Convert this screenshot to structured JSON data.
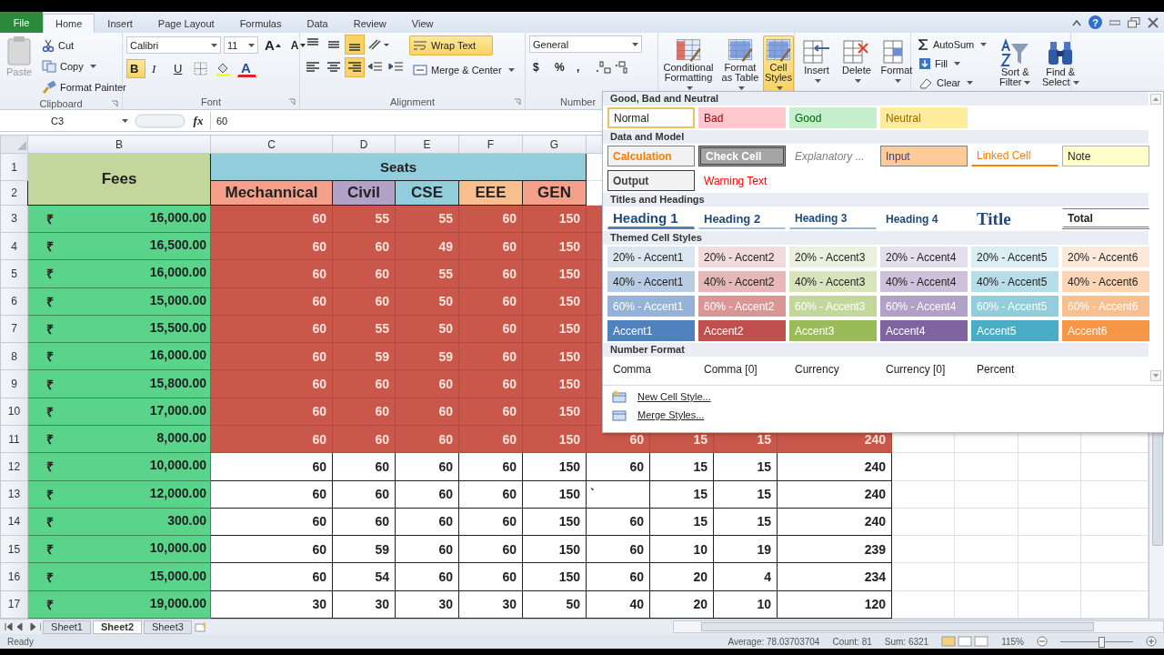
{
  "file_tab": "File",
  "ribbon_tabs": [
    {
      "label": "Home",
      "selected": true
    },
    {
      "label": "Insert",
      "selected": false
    },
    {
      "label": "Page Layout",
      "selected": false
    },
    {
      "label": "Formulas",
      "selected": false
    },
    {
      "label": "Data",
      "selected": false
    },
    {
      "label": "Review",
      "selected": false
    },
    {
      "label": "View",
      "selected": false
    }
  ],
  "help": "?",
  "clipboard": {
    "paste": "Paste",
    "paste_disabled": true,
    "cut": "Cut",
    "copy": "Copy",
    "format_painter": "Format Painter",
    "label": "Clipboard"
  },
  "font": {
    "family": "Calibri",
    "size": "11",
    "grow": "A",
    "shrink": "A",
    "bold": "B",
    "italic": "I",
    "underline": "U",
    "color_letter": "A",
    "bold_on": true,
    "label": "Font"
  },
  "alignment": {
    "vertical_buttons": [
      {
        "selected": false
      },
      {
        "selected": false
      },
      {
        "selected": true
      }
    ],
    "horizontal_buttons": [
      {
        "selected": false
      },
      {
        "selected": false
      },
      {
        "selected": true
      }
    ],
    "wrap_text": "Wrap Text",
    "wrap_on": true,
    "merge": "Merge & Center",
    "label": "Alignment"
  },
  "number": {
    "format": "General",
    "symbols": [
      "$",
      "%",
      ","
    ],
    "label": "Number"
  },
  "styles": [
    {
      "label": "Conditional Formatting",
      "selected": false
    },
    {
      "label": "Format as Table",
      "selected": false
    },
    {
      "label": "Cell Styles",
      "selected": true
    }
  ],
  "cells": [
    "Insert",
    "Delete",
    "Format"
  ],
  "editing": {
    "autosum": "AutoSum",
    "fill": "Fill",
    "clear": "Clear",
    "sort": "Sort & Filter",
    "find": "Find & Select"
  },
  "formula_bar": {
    "name_box": "C3",
    "function_label": "fx",
    "formula": "60"
  },
  "column_headers": [
    "B",
    "C",
    "D",
    "E",
    "F",
    "G"
  ],
  "sheet": {
    "header_rows": [
      "1",
      "2"
    ],
    "fees_header": "Fees",
    "seats_header": "Seats",
    "subheaders": [
      {
        "label": "Mechannical",
        "color": "#f4a08a"
      },
      {
        "label": "Civil",
        "color": "#b3a2c7"
      },
      {
        "label": "CSE",
        "color": "#92cddc"
      },
      {
        "label": "EEE",
        "color": "#fabf8f"
      },
      {
        "label": "GEN",
        "color": "#f4a08a"
      }
    ],
    "rows": [
      {
        "number": "3",
        "symbol": "₹",
        "fee": "16,000.00",
        "highlighted": true,
        "values": [
          "60",
          "55",
          "55",
          "60",
          "150"
        ]
      },
      {
        "number": "4",
        "symbol": "₹",
        "fee": "16,500.00",
        "highlighted": true,
        "values": [
          "60",
          "60",
          "49",
          "60",
          "150"
        ]
      },
      {
        "number": "5",
        "symbol": "₹",
        "fee": "16,000.00",
        "highlighted": true,
        "values": [
          "60",
          "60",
          "55",
          "60",
          "150"
        ]
      },
      {
        "number": "6",
        "symbol": "₹",
        "fee": "15,000.00",
        "highlighted": true,
        "values": [
          "60",
          "60",
          "50",
          "60",
          "150"
        ]
      },
      {
        "number": "7",
        "symbol": "₹",
        "fee": "15,500.00",
        "highlighted": true,
        "values": [
          "60",
          "55",
          "50",
          "60",
          "150"
        ]
      },
      {
        "number": "8",
        "symbol": "₹",
        "fee": "16,000.00",
        "highlighted": true,
        "values": [
          "60",
          "59",
          "59",
          "60",
          "150"
        ]
      },
      {
        "number": "9",
        "symbol": "₹",
        "fee": "15,800.00",
        "highlighted": true,
        "values": [
          "60",
          "60",
          "60",
          "60",
          "150"
        ]
      },
      {
        "number": "10",
        "symbol": "₹",
        "fee": "17,000.00",
        "highlighted": true,
        "values": [
          "60",
          "60",
          "60",
          "60",
          "150"
        ]
      },
      {
        "number": "11",
        "symbol": "₹",
        "fee": "8,000.00",
        "highlighted": true,
        "values": [
          "60",
          "60",
          "60",
          "60",
          "150",
          "60",
          "15",
          "15",
          "240"
        ]
      },
      {
        "number": "12",
        "symbol": "₹",
        "fee": "10,000.00",
        "highlighted": false,
        "values": [
          "60",
          "60",
          "60",
          "60",
          "150",
          "60",
          "15",
          "15",
          "240"
        ]
      },
      {
        "number": "13",
        "symbol": "₹",
        "fee": "12,000.00",
        "highlighted": false,
        "values": [
          "60",
          "60",
          "60",
          "60",
          "150",
          "`",
          "15",
          "15",
          "240"
        ]
      },
      {
        "number": "14",
        "symbol": "₹",
        "fee": "300.00",
        "highlighted": false,
        "values": [
          "60",
          "60",
          "60",
          "60",
          "150",
          "60",
          "15",
          "15",
          "240"
        ]
      },
      {
        "number": "15",
        "symbol": "₹",
        "fee": "10,000.00",
        "highlighted": false,
        "values": [
          "60",
          "59",
          "60",
          "60",
          "150",
          "60",
          "10",
          "19",
          "239"
        ]
      },
      {
        "number": "16",
        "symbol": "₹",
        "fee": "15,000.00",
        "highlighted": false,
        "values": [
          "60",
          "54",
          "60",
          "60",
          "150",
          "60",
          "20",
          "4",
          "234"
        ]
      },
      {
        "number": "17",
        "symbol": "₹",
        "fee": "19,000.00",
        "highlighted": false,
        "values": [
          "30",
          "30",
          "30",
          "30",
          "50",
          "40",
          "20",
          "10",
          "120"
        ]
      }
    ]
  },
  "cell_styles": {
    "sections": [
      {
        "title": "Good, Bad and Neutral",
        "rows": [
          [
            {
              "label": "Normal",
              "kind": "normal",
              "selected": true
            },
            {
              "label": "Bad",
              "kind": "bad",
              "selected": false
            },
            {
              "label": "Good",
              "kind": "good",
              "selected": false
            },
            {
              "label": "Neutral",
              "kind": "neutral",
              "selected": false
            }
          ]
        ]
      },
      {
        "title": "Data and Model",
        "rows": [
          [
            {
              "label": "Calculation",
              "kind": "calculation",
              "selected": false
            },
            {
              "label": "Check Cell",
              "kind": "check",
              "selected": false
            },
            {
              "label": "Explanatory ...",
              "kind": "explanatory",
              "selected": false
            },
            {
              "label": "Input",
              "kind": "input",
              "selected": false
            },
            {
              "label": "Linked Cell",
              "kind": "linked",
              "selected": false
            },
            {
              "label": "Note",
              "kind": "note",
              "selected": false
            }
          ],
          [
            {
              "label": "Output",
              "kind": "output",
              "selected": false
            },
            {
              "label": "Warning Text",
              "kind": "warning",
              "selected": false
            }
          ]
        ]
      },
      {
        "title": "Titles and Headings",
        "rows": [
          [
            {
              "label": "Heading 1",
              "kind": "h1",
              "selected": false
            },
            {
              "label": "Heading 2",
              "kind": "h2",
              "selected": false
            },
            {
              "label": "Heading 3",
              "kind": "h3",
              "selected": false
            },
            {
              "label": "Heading 4",
              "kind": "h4",
              "selected": false
            },
            {
              "label": "Title",
              "kind": "title",
              "selected": false
            },
            {
              "label": "Total",
              "kind": "total",
              "selected": false
            }
          ]
        ]
      },
      {
        "title": "Themed Cell Styles",
        "rows": [
          [
            {
              "label": "20% - Accent1",
              "kind": "percent20",
              "selected": false
            },
            {
              "label": "20% - Accent2",
              "kind": "percent20",
              "selected": false
            },
            {
              "label": "20% - Accent3",
              "kind": "percent20",
              "selected": false
            },
            {
              "label": "20% - Accent4",
              "kind": "percent20",
              "selected": false
            },
            {
              "label": "20% - Accent5",
              "kind": "percent20",
              "selected": false
            },
            {
              "label": "20% - Accent6",
              "kind": "percent20",
              "selected": false
            }
          ],
          [
            {
              "label": "40% - Accent1",
              "kind": "percent40",
              "selected": false
            },
            {
              "label": "40% - Accent2",
              "kind": "percent40",
              "selected": false
            },
            {
              "label": "40% - Accent3",
              "kind": "percent40",
              "selected": false
            },
            {
              "label": "40% - Accent4",
              "kind": "percent40",
              "selected": false
            },
            {
              "label": "40% - Accent5",
              "kind": "percent40",
              "selected": false
            },
            {
              "label": "40% - Accent6",
              "kind": "percent40",
              "selected": false
            }
          ],
          [
            {
              "label": "60% - Accent1",
              "kind": "percent60",
              "selected": false
            },
            {
              "label": "60% - Accent2",
              "kind": "percent60",
              "selected": false
            },
            {
              "label": "60% - Accent3",
              "kind": "percent60",
              "selected": false
            },
            {
              "label": "60% - Accent4",
              "kind": "percent60",
              "selected": false
            },
            {
              "label": "60% - Accent5",
              "kind": "percent60",
              "selected": false
            },
            {
              "label": "60% - Accent6",
              "kind": "percent60",
              "selected": false
            }
          ],
          [
            {
              "label": "Accent1",
              "kind": "accent",
              "selected": false
            },
            {
              "label": "Accent2",
              "kind": "accent",
              "selected": false
            },
            {
              "label": "Accent3",
              "kind": "accent",
              "selected": false
            },
            {
              "label": "Accent4",
              "kind": "accent",
              "selected": false
            },
            {
              "label": "Accent5",
              "kind": "accent",
              "selected": false
            },
            {
              "label": "Accent6",
              "kind": "accent",
              "selected": false
            }
          ]
        ]
      },
      {
        "title": "Number Format",
        "rows": [
          [
            {
              "label": "Comma",
              "kind": "plain",
              "selected": false
            },
            {
              "label": "Comma [0]",
              "kind": "plain",
              "selected": false
            },
            {
              "label": "Currency",
              "kind": "plain",
              "selected": false
            },
            {
              "label": "Currency [0]",
              "kind": "plain",
              "selected": false
            },
            {
              "label": "Percent",
              "kind": "plain",
              "selected": false
            }
          ]
        ]
      }
    ],
    "actions": [
      "New Cell Style...",
      "Merge Styles..."
    ]
  },
  "sheets": [
    {
      "label": "Sheet1",
      "selected": false
    },
    {
      "label": "Sheet2",
      "selected": true
    },
    {
      "label": "Sheet3",
      "selected": false
    }
  ],
  "status_bar": {
    "mode": "Ready",
    "average": "Average: 78.03703704",
    "count": "Count: 81",
    "sum": "Sum: 6321",
    "zoom": "115%",
    "level": 0.55
  }
}
